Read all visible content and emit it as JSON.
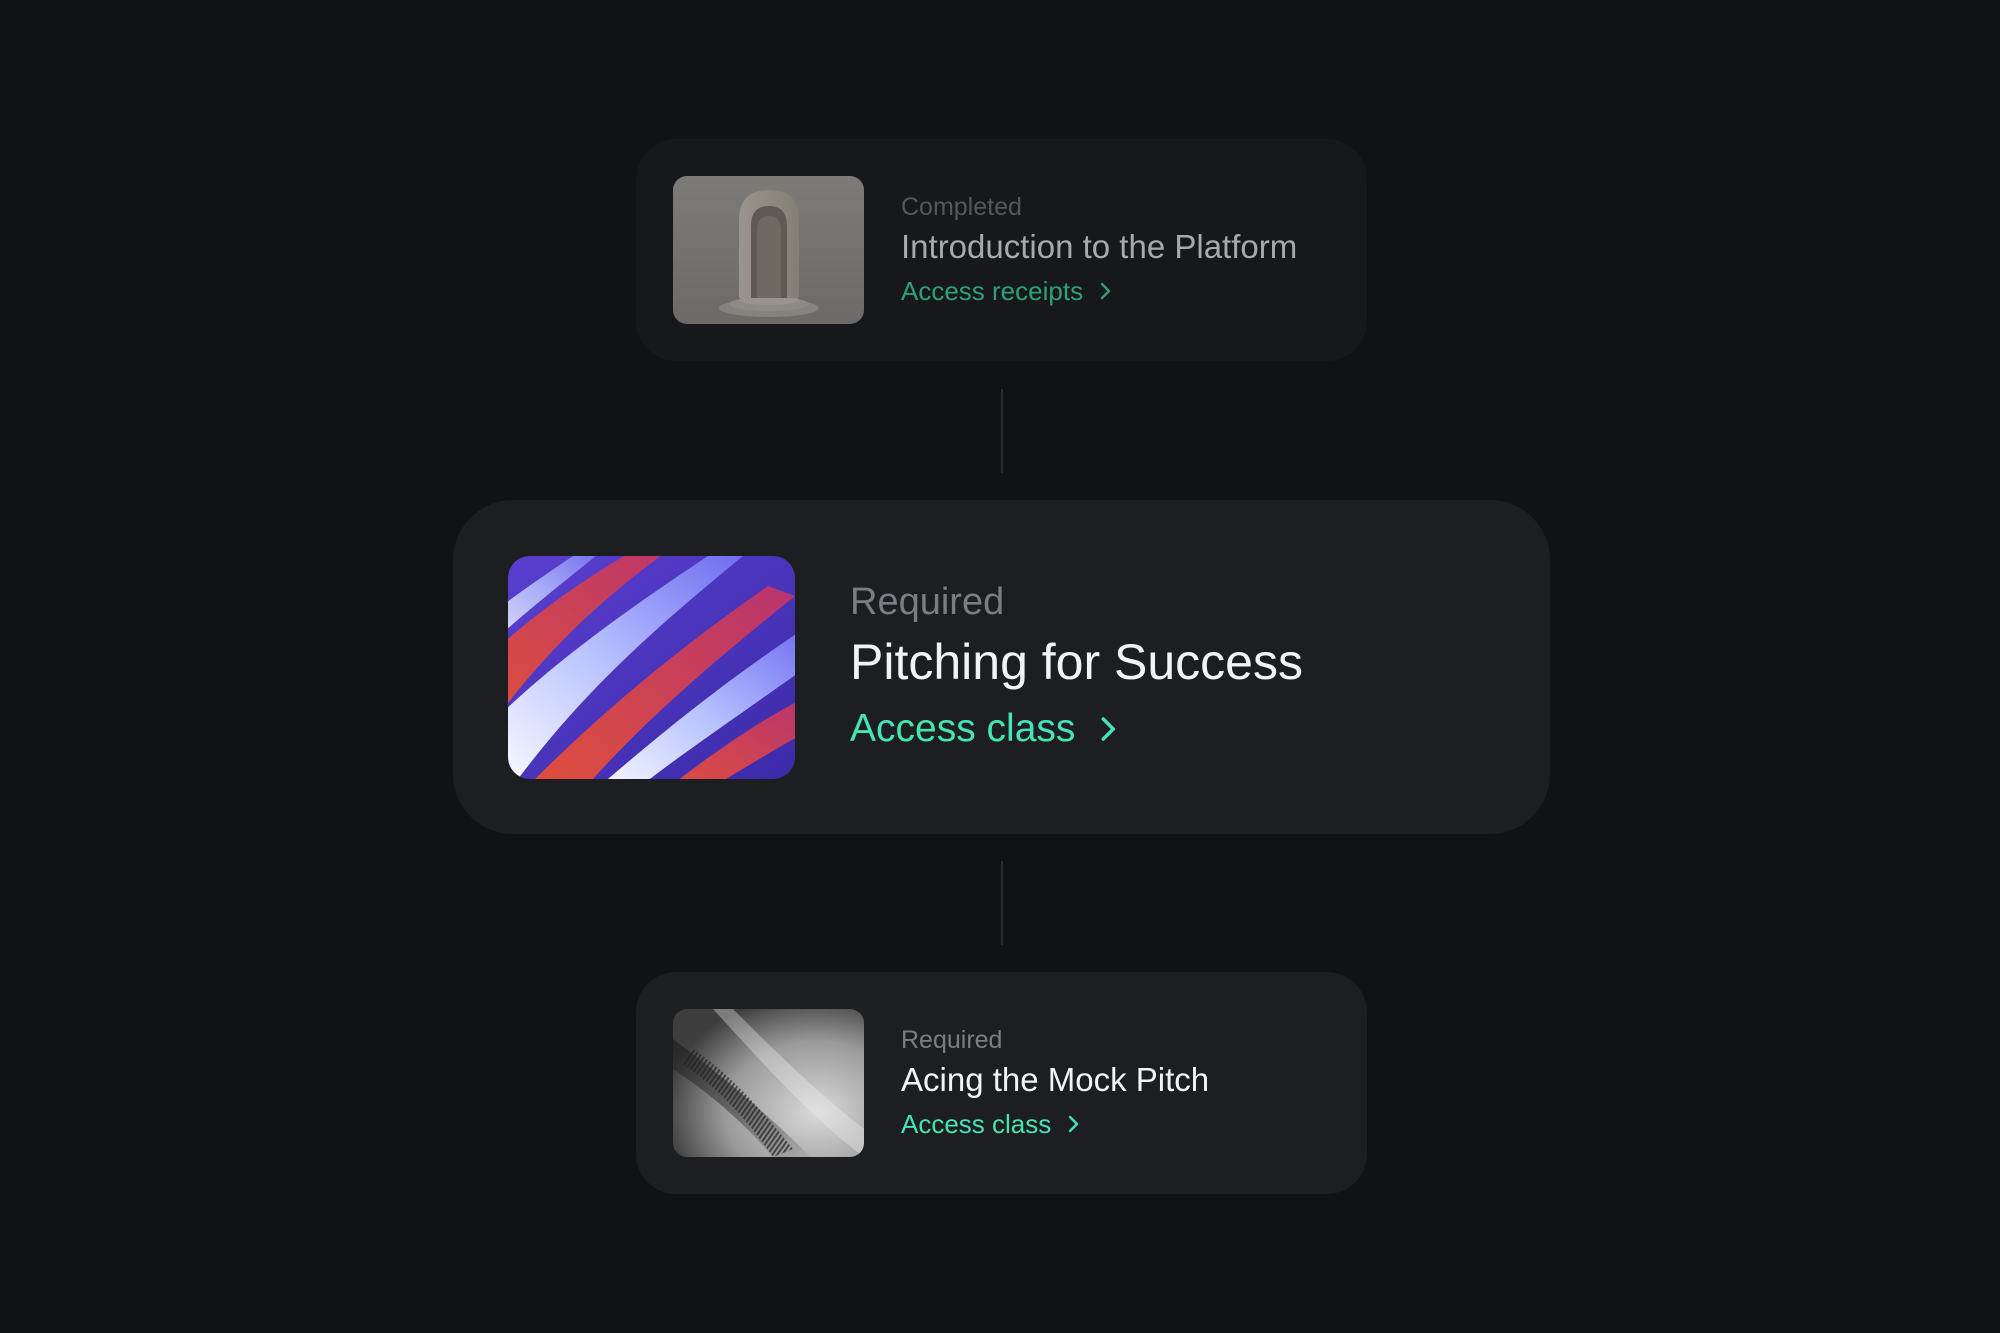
{
  "steps": [
    {
      "status": "Completed",
      "title": "Introduction to the Platform",
      "link_label": "Access receipts",
      "image": "arch-doorway-thumbnail"
    },
    {
      "status": "Required",
      "title": "Pitching for Success",
      "link_label": "Access class",
      "image": "abstract-waves-thumbnail"
    },
    {
      "status": "Required",
      "title": "Acing the Mock Pitch",
      "link_label": "Access class",
      "image": "monochrome-texture-thumbnail"
    }
  ],
  "colors": {
    "background": "#111214",
    "card": "#1d1e21",
    "accent": "#46e3b5",
    "accent_dimmed": "#2e9f7d"
  },
  "icons": {
    "link_arrow": "chevron-right-icon"
  }
}
